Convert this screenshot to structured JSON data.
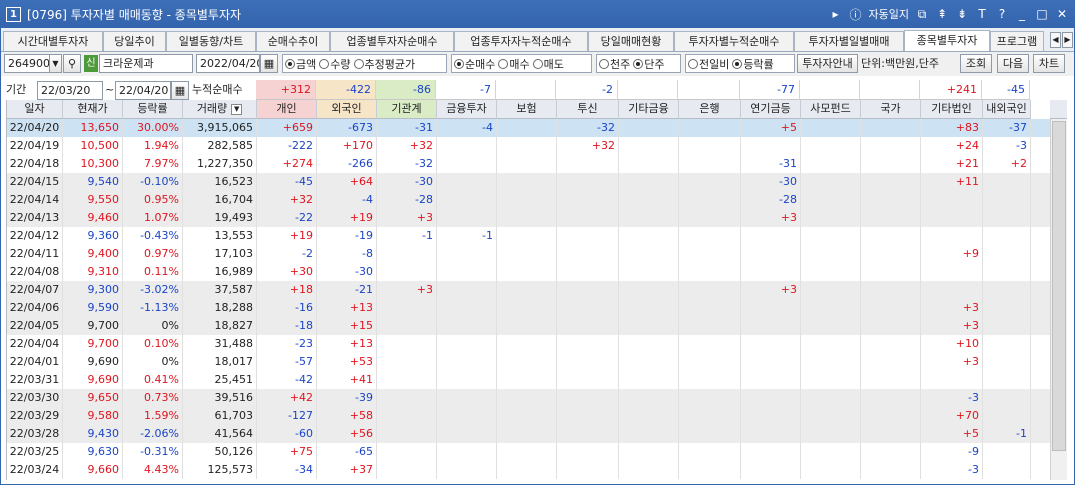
{
  "window": {
    "number": "1",
    "title": "[0796] 투자자별 매매동향 - 종목별투자자",
    "auto_log": "자동일지",
    "controls": [
      "▸",
      "ⓘ",
      "⧉",
      "⇞",
      "⇟",
      "T",
      "?",
      "_",
      "□",
      "✕"
    ]
  },
  "tabs": [
    {
      "label": "시간대별투자자",
      "active": false
    },
    {
      "label": "당일추이",
      "active": false
    },
    {
      "label": "일별동향/차트",
      "active": false
    },
    {
      "label": "순매수추이",
      "active": false
    },
    {
      "label": "업종별투자자순매수",
      "active": false
    },
    {
      "label": "업종투자자누적순매수",
      "active": false
    },
    {
      "label": "당일매매현황",
      "active": false
    },
    {
      "label": "투자자별누적순매수",
      "active": false
    },
    {
      "label": "투자자별일별매매",
      "active": false
    },
    {
      "label": "종목별투자자",
      "active": true
    },
    {
      "label": "프로그램",
      "active": false
    }
  ],
  "toolbar": {
    "code": "264900",
    "code_dropdown": "▼",
    "search_icon": "⚲",
    "badge": "신",
    "stock_name": "크라운제과",
    "date": "2022/04/20",
    "calendar_icon": "▦",
    "value_radios": [
      {
        "label": "금액",
        "on": true
      },
      {
        "label": "수량",
        "on": false
      },
      {
        "label": "추정평균가",
        "on": false
      }
    ],
    "trade_radios": [
      {
        "label": "순매수",
        "on": true
      },
      {
        "label": "매수",
        "on": false
      },
      {
        "label": "매도",
        "on": false
      }
    ],
    "unit_radios": [
      {
        "label": "천주",
        "on": false
      },
      {
        "label": "단주",
        "on": true
      }
    ],
    "compare_radios": [
      {
        "label": "전일비",
        "on": false
      },
      {
        "label": "등락률",
        "on": true
      }
    ],
    "guide_button": "투자자안내",
    "unit_label": "단위:백만원,단주",
    "search_button": "조회",
    "next_button": "다음",
    "chart_button": "차트"
  },
  "period": {
    "label": "기간",
    "start": "22/03/20",
    "separator": "~",
    "end": "22/04/20",
    "cum_label": "누적순매수",
    "sums": [
      "+312",
      "-422",
      "-86",
      "-7",
      "",
      "-2",
      "",
      "",
      "-77",
      "",
      "",
      "+241",
      "-45"
    ]
  },
  "columns": [
    "일자",
    "현재가",
    "등락률",
    "거래량",
    "개인",
    "외국인",
    "기관계",
    "금융투자",
    "보험",
    "투신",
    "기타금융",
    "은행",
    "연기금등",
    "사모펀드",
    "국가",
    "기타법인",
    "내외국인"
  ],
  "sort_icon": "▼",
  "rows": [
    [
      "22/04/20",
      "13,650",
      "30.00%",
      "3,915,065",
      "+659",
      "-673",
      "-31",
      "-4",
      "",
      "-32",
      "",
      "",
      "+5",
      "",
      "",
      "+83",
      "-37"
    ],
    [
      "22/04/19",
      "10,500",
      "1.94%",
      "282,585",
      "-222",
      "+170",
      "+32",
      "",
      "",
      "+32",
      "",
      "",
      "",
      "",
      "",
      "+24",
      "-3"
    ],
    [
      "22/04/18",
      "10,300",
      "7.97%",
      "1,227,350",
      "+274",
      "-266",
      "-32",
      "",
      "",
      "",
      "",
      "",
      "-31",
      "",
      "",
      "+21",
      "+2"
    ],
    [
      "22/04/15",
      "9,540",
      "-0.10%",
      "16,523",
      "-45",
      "+64",
      "-30",
      "",
      "",
      "",
      "",
      "",
      "-30",
      "",
      "",
      "+11",
      ""
    ],
    [
      "22/04/14",
      "9,550",
      "0.95%",
      "16,704",
      "+32",
      "-4",
      "-28",
      "",
      "",
      "",
      "",
      "",
      "-28",
      "",
      "",
      "",
      ""
    ],
    [
      "22/04/13",
      "9,460",
      "1.07%",
      "19,493",
      "-22",
      "+19",
      "+3",
      "",
      "",
      "",
      "",
      "",
      "+3",
      "",
      "",
      "",
      ""
    ],
    [
      "22/04/12",
      "9,360",
      "-0.43%",
      "13,553",
      "+19",
      "-19",
      "-1",
      "-1",
      "",
      "",
      "",
      "",
      "",
      "",
      "",
      "",
      ""
    ],
    [
      "22/04/11",
      "9,400",
      "0.97%",
      "17,103",
      "-2",
      "-8",
      "",
      "",
      "",
      "",
      "",
      "",
      "",
      "",
      "",
      "+9",
      ""
    ],
    [
      "22/04/08",
      "9,310",
      "0.11%",
      "16,989",
      "+30",
      "-30",
      "",
      "",
      "",
      "",
      "",
      "",
      "",
      "",
      "",
      "",
      ""
    ],
    [
      "22/04/07",
      "9,300",
      "-3.02%",
      "37,587",
      "+18",
      "-21",
      "+3",
      "",
      "",
      "",
      "",
      "",
      "+3",
      "",
      "",
      "",
      ""
    ],
    [
      "22/04/06",
      "9,590",
      "-1.13%",
      "18,288",
      "-16",
      "+13",
      "",
      "",
      "",
      "",
      "",
      "",
      "",
      "",
      "",
      "+3",
      ""
    ],
    [
      "22/04/05",
      "9,700",
      "0%",
      "18,827",
      "-18",
      "+15",
      "",
      "",
      "",
      "",
      "",
      "",
      "",
      "",
      "",
      "+3",
      ""
    ],
    [
      "22/04/04",
      "9,700",
      "0.10%",
      "31,488",
      "-23",
      "+13",
      "",
      "",
      "",
      "",
      "",
      "",
      "",
      "",
      "",
      "+10",
      ""
    ],
    [
      "22/04/01",
      "9,690",
      "0%",
      "18,017",
      "-57",
      "+53",
      "",
      "",
      "",
      "",
      "",
      "",
      "",
      "",
      "",
      "+3",
      ""
    ],
    [
      "22/03/31",
      "9,690",
      "0.41%",
      "25,451",
      "-42",
      "+41",
      "",
      "",
      "",
      "",
      "",
      "",
      "",
      "",
      "",
      "",
      ""
    ],
    [
      "22/03/30",
      "9,650",
      "0.73%",
      "39,516",
      "+42",
      "-39",
      "",
      "",
      "",
      "",
      "",
      "",
      "",
      "",
      "",
      "-3",
      ""
    ],
    [
      "22/03/29",
      "9,580",
      "1.59%",
      "61,703",
      "-127",
      "+58",
      "",
      "",
      "",
      "",
      "",
      "",
      "",
      "",
      "",
      "+70",
      ""
    ],
    [
      "22/03/28",
      "9,430",
      "-2.06%",
      "41,564",
      "-60",
      "+56",
      "",
      "",
      "",
      "",
      "",
      "",
      "",
      "",
      "",
      "+5",
      "-1"
    ],
    [
      "22/03/25",
      "9,630",
      "-0.31%",
      "50,126",
      "+75",
      "-65",
      "",
      "",
      "",
      "",
      "",
      "",
      "",
      "",
      "",
      "-9",
      ""
    ],
    [
      "22/03/24",
      "9,660",
      "4.43%",
      "125,573",
      "-34",
      "+37",
      "",
      "",
      "",
      "",
      "",
      "",
      "",
      "",
      "",
      "-3",
      ""
    ]
  ],
  "colors": {
    "title_bar": "#3364ad",
    "up": "#e0141e",
    "down": "#1a44c8",
    "selected_row": "#cde3f3",
    "shaded_row": "#ececec",
    "personal_head": "#f6d2d2",
    "foreign_head": "#f7e5c8",
    "inst_head": "#d9ecc5"
  }
}
